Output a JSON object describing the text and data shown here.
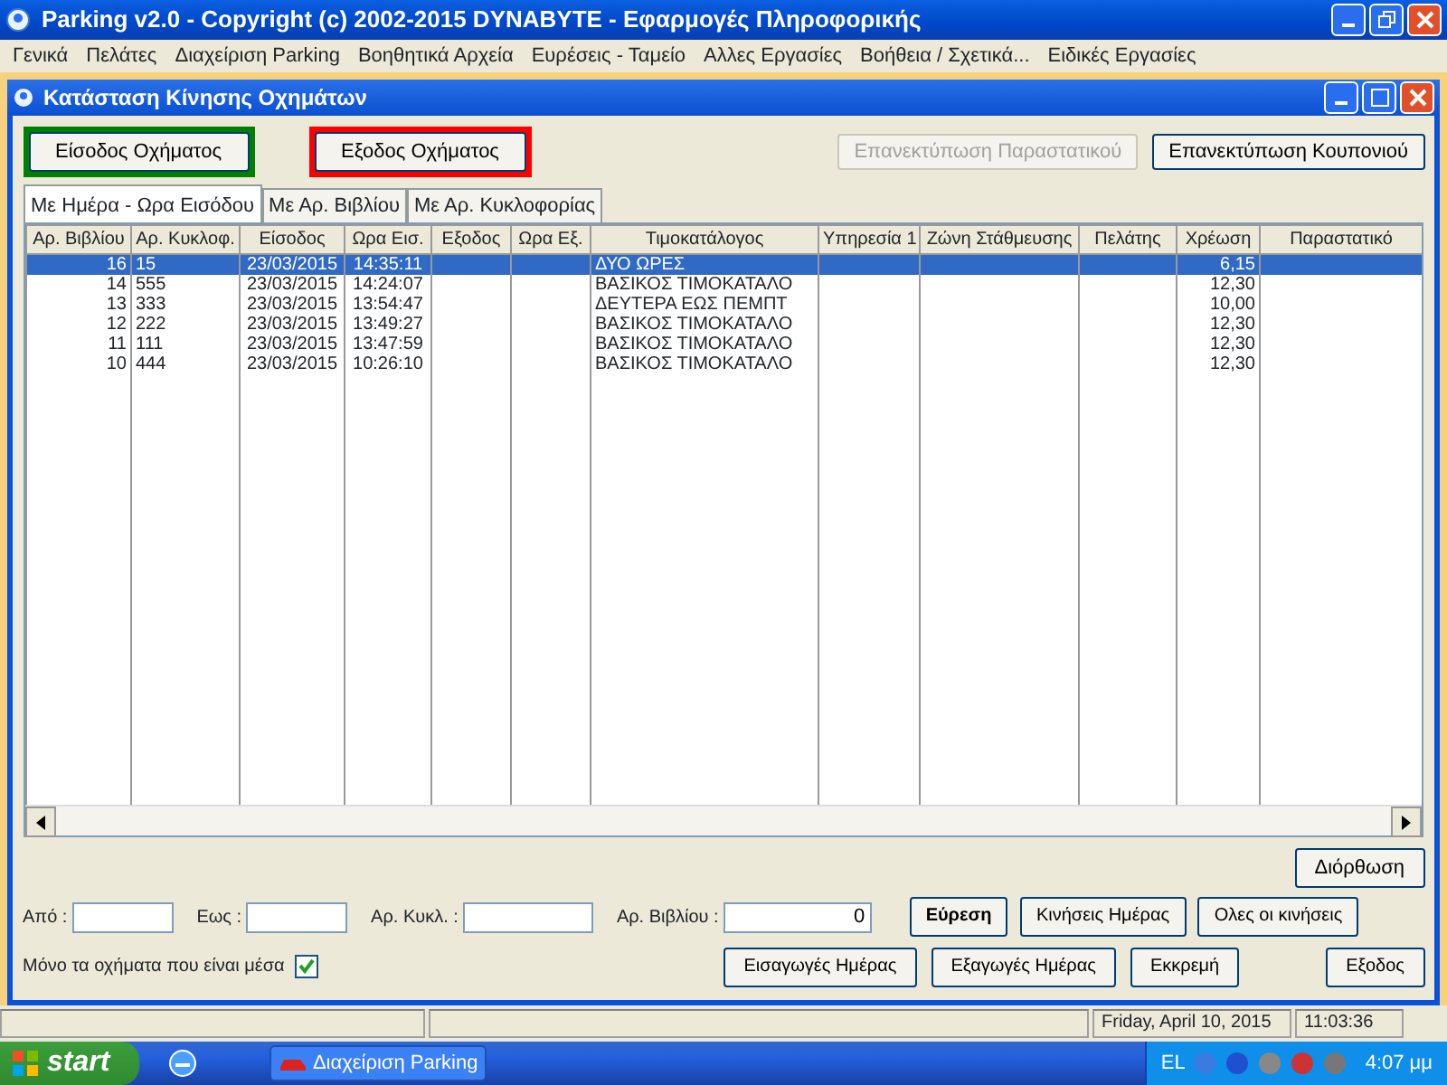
{
  "app_window": {
    "title": "Parking  v2.0   -   Copyright (c) 2002-2015  DYNABYTE - Εφαρμογές Πληροφορικής"
  },
  "menu": [
    "Γενικά",
    "Πελάτες",
    "Διαχείριση Parking",
    "Βοηθητικά Αρχεία",
    "Ευρέσεις - Ταμείο",
    "Αλλες Εργασίες",
    "Βοήθεια / Σχετικά...",
    "Ειδικές Εργασίες"
  ],
  "child_window": {
    "title": "Κατάσταση Κίνησης Οχημάτων"
  },
  "top_buttons": [
    {
      "label": "Είσοδος Οχήματος",
      "color": "#008000",
      "disabled": false
    },
    {
      "label": "Εξοδος Οχήματος",
      "color": "#ff0000",
      "disabled": false
    },
    {
      "label": "Επανεκτύπωση Παραστατικού",
      "disabled": true
    },
    {
      "label": "Επανεκτύπωση Κουπονιού",
      "disabled": false
    }
  ],
  "tabs": [
    {
      "label": "Με Ημέρα - Ωρα Εισόδου",
      "selected": true
    },
    {
      "label": "Με Αρ. Βιβλίου",
      "selected": false
    },
    {
      "label": "Με Αρ. Κυκλοφορίας",
      "selected": false
    }
  ],
  "table": {
    "columns": [
      "Αρ. Βιβλίου",
      "Αρ. Κυκλοφ.",
      "Είσοδος",
      "Ωρα Εισ.",
      "Εξοδος",
      "Ωρα Εξ.",
      "Τιμοκατάλογος",
      "Υπηρεσία 1",
      "Ζώνη Στάθμευσης",
      "Πελάτης",
      "Χρέωση",
      "Παραστατικό"
    ],
    "rows": [
      {
        "selected": true,
        "cells": [
          "16",
          "15",
          "23/03/2015",
          "14:35:11",
          "",
          "",
          "ΔΥΟ ΩΡΕΣ",
          "",
          "",
          "",
          "6,15",
          ""
        ]
      },
      {
        "selected": false,
        "cells": [
          "14",
          "555",
          "23/03/2015",
          "14:24:07",
          "",
          "",
          "ΒΑΣΙΚΟΣ ΤΙΜΟΚΑΤΑΛΟ",
          "",
          "",
          "",
          "12,30",
          ""
        ]
      },
      {
        "selected": false,
        "cells": [
          "13",
          "333",
          "23/03/2015",
          "13:54:47",
          "",
          "",
          "ΔΕΥΤΕΡΑ ΕΩΣ ΠΕΜΠΤ",
          "",
          "",
          "",
          "10,00",
          ""
        ]
      },
      {
        "selected": false,
        "cells": [
          "12",
          "222",
          "23/03/2015",
          "13:49:27",
          "",
          "",
          "ΒΑΣΙΚΟΣ ΤΙΜΟΚΑΤΑΛΟ",
          "",
          "",
          "",
          "12,30",
          ""
        ]
      },
      {
        "selected": false,
        "cells": [
          "11",
          "111",
          "23/03/2015",
          "13:47:59",
          "",
          "",
          "ΒΑΣΙΚΟΣ ΤΙΜΟΚΑΤΑΛΟ",
          "",
          "",
          "",
          "12,30",
          ""
        ]
      },
      {
        "selected": false,
        "cells": [
          "10",
          "444",
          "23/03/2015",
          "10:26:10",
          "",
          "",
          "ΒΑΣΙΚΟΣ ΤΙΜΟΚΑΤΑΛΟ",
          "",
          "",
          "",
          "12,30",
          ""
        ]
      }
    ]
  },
  "edit_button": "Διόρθωση",
  "filters": [
    {
      "label": "Από :"
    },
    {
      "label": "Εως :"
    },
    {
      "label": "Αρ. Κυκλ. :"
    },
    {
      "label": "Αρ. Βιβλίου :",
      "value": "0"
    }
  ],
  "filter_buttons": [
    {
      "label": "Εύρεση",
      "bold": true
    },
    {
      "label": "Κινήσεις Ημέρας",
      "bold": false
    },
    {
      "label": "Ολες οι κινήσεις",
      "bold": false
    }
  ],
  "inside_only": {
    "label": "Μόνο τα οχήματα που είναι μέσα",
    "checked": true
  },
  "bottom_buttons": [
    "Εισαγωγές Ημέρας",
    "Εξαγωγές Ημέρας",
    "Εκκρεμή",
    "Εξοδος"
  ],
  "status_bar": {
    "date": "Friday, April 10, 2015",
    "time": "11:03:36"
  },
  "taskbar": {
    "start": "start",
    "task": "Διαχείριση Parking",
    "language": "EL",
    "clock": "4:07 μμ"
  }
}
